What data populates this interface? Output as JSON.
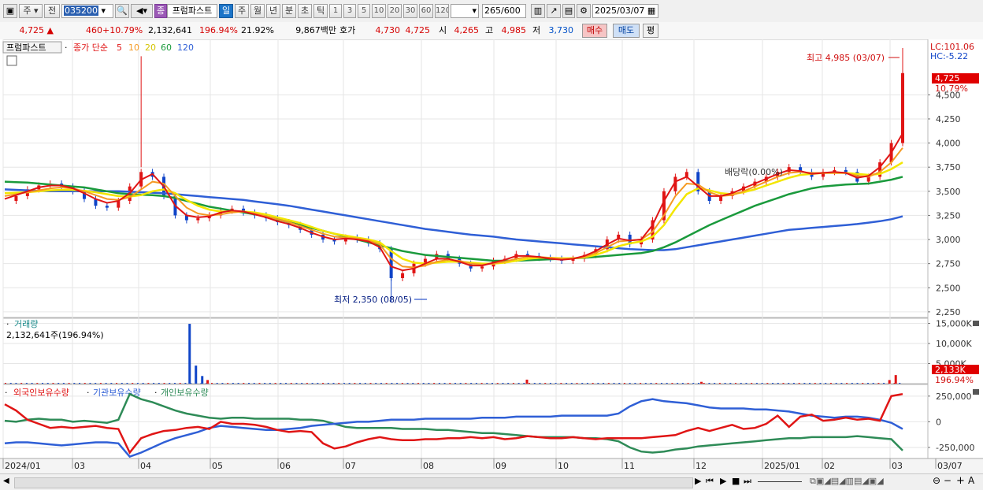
{
  "toolbar": {
    "market_label": "주",
    "prev_label": "전",
    "code": "035200",
    "name_badge": "종",
    "name": "프럼파스트",
    "periods": [
      "일",
      "주",
      "월",
      "년",
      "분",
      "초",
      "틱"
    ],
    "selected_period": "일",
    "minute_options": [
      "1",
      "3",
      "5",
      "10",
      "20",
      "30",
      "60",
      "120"
    ],
    "count_value": "265",
    "count_total": "/600",
    "date": "2025/03/07"
  },
  "quote": {
    "price": "4,725",
    "change": "460",
    "change_pct": "+10.79%",
    "volume": "2,132,641",
    "volume_ratio": "196.94%",
    "turnover": "21.92%",
    "amount": "9,867백만",
    "ask_label": "호가",
    "ask_price": "4,730",
    "bid_price": "4,725",
    "open_label": "시",
    "open": "4,265",
    "high_label": "고",
    "high": "4,985",
    "low_label": "저",
    "low": "3,730",
    "buy_label": "매수",
    "sell_label": "매도",
    "eval_label": "평"
  },
  "colors": {
    "up": "#e01515",
    "down": "#1045c8",
    "ma5": "#e01515",
    "ma10": "#f59a23",
    "ma20": "#f3e600",
    "ma60": "#1a9a3c",
    "ma120": "#2f5fd6",
    "foreign": "#e01515",
    "institution": "#2f5fd6",
    "individual": "#2e8b57"
  },
  "chart_data": [
    {
      "type": "line",
      "title": "프럼파스트",
      "legend": {
        "prefix": "종가 단순",
        "periods": [
          "5",
          "10",
          "20",
          "60",
          "120"
        ]
      },
      "ylim": [
        2200,
        5050
      ],
      "yticks": [
        "4,500",
        "4,250",
        "4,000",
        "3,750",
        "3,500",
        "3,250",
        "3,000",
        "2,750",
        "2,500",
        "2,250"
      ],
      "right_info": {
        "lc": "LC:101.06",
        "hc": "HC:-5.22",
        "last": "4,725",
        "last_pct": "10.79%"
      },
      "high_note": "최고 4,985 (03/07)",
      "low_note": "최저 2,350 (08/05)",
      "event_note": "배당락(0.00%)",
      "x_labels": [
        "2024/01",
        "03",
        "04",
        "05",
        "06",
        "07",
        "08",
        "09",
        "10",
        "11",
        "12",
        "2025/01",
        "02",
        "03",
        "03/07"
      ],
      "close": [
        3400,
        3450,
        3520,
        3560,
        3580,
        3550,
        3500,
        3420,
        3350,
        3330,
        3400,
        3550,
        3700,
        3650,
        3450,
        3250,
        3200,
        3220,
        3250,
        3300,
        3320,
        3280,
        3250,
        3220,
        3180,
        3150,
        3100,
        3050,
        3000,
        2980,
        3020,
        3000,
        2960,
        2900,
        2600,
        2650,
        2750,
        2800,
        2850,
        2800,
        2750,
        2700,
        2720,
        2780,
        2800,
        2850,
        2830,
        2810,
        2800,
        2780,
        2800,
        2840,
        2900,
        3000,
        3050,
        2950,
        3000,
        3200,
        3500,
        3650,
        3700,
        3500,
        3400,
        3450,
        3500,
        3550,
        3600,
        3650,
        3700,
        3750,
        3700,
        3650,
        3700,
        3720,
        3700,
        3600,
        3650,
        3800,
        4000,
        4725
      ],
      "ma5": [
        3420,
        3460,
        3500,
        3540,
        3560,
        3560,
        3530,
        3480,
        3420,
        3380,
        3400,
        3480,
        3620,
        3680,
        3550,
        3350,
        3250,
        3230,
        3240,
        3280,
        3300,
        3290,
        3260,
        3230,
        3190,
        3160,
        3120,
        3070,
        3030,
        3000,
        3010,
        3000,
        2980,
        2920,
        2720,
        2680,
        2700,
        2750,
        2800,
        2800,
        2770,
        2730,
        2730,
        2760,
        2790,
        2830,
        2830,
        2820,
        2800,
        2790,
        2800,
        2830,
        2880,
        2950,
        3010,
        2990,
        3000,
        3150,
        3400,
        3600,
        3650,
        3550,
        3450,
        3450,
        3480,
        3530,
        3580,
        3630,
        3680,
        3720,
        3710,
        3680,
        3690,
        3700,
        3690,
        3640,
        3660,
        3750,
        3900,
        4100
      ],
      "ma10": [
        3450,
        3470,
        3490,
        3510,
        3530,
        3540,
        3530,
        3500,
        3460,
        3420,
        3410,
        3440,
        3520,
        3600,
        3580,
        3450,
        3330,
        3270,
        3250,
        3260,
        3280,
        3290,
        3270,
        3240,
        3210,
        3180,
        3140,
        3100,
        3060,
        3030,
        3020,
        3010,
        2990,
        2950,
        2800,
        2720,
        2710,
        2730,
        2770,
        2790,
        2780,
        2750,
        2740,
        2750,
        2770,
        2800,
        2820,
        2820,
        2810,
        2800,
        2800,
        2820,
        2860,
        2920,
        2980,
        2990,
        3000,
        3080,
        3250,
        3450,
        3580,
        3570,
        3490,
        3450,
        3460,
        3500,
        3550,
        3600,
        3650,
        3690,
        3700,
        3690,
        3690,
        3690,
        3690,
        3660,
        3650,
        3700,
        3800,
        3950
      ],
      "ma20": [
        3480,
        3485,
        3490,
        3500,
        3510,
        3515,
        3515,
        3505,
        3490,
        3470,
        3450,
        3445,
        3460,
        3500,
        3520,
        3480,
        3410,
        3350,
        3310,
        3290,
        3290,
        3290,
        3280,
        3260,
        3230,
        3200,
        3170,
        3130,
        3090,
        3060,
        3040,
        3020,
        3000,
        2970,
        2880,
        2800,
        2760,
        2750,
        2760,
        2770,
        2770,
        2760,
        2750,
        2750,
        2760,
        2780,
        2800,
        2810,
        2810,
        2805,
        2805,
        2815,
        2840,
        2880,
        2930,
        2960,
        2980,
        3030,
        3150,
        3320,
        3470,
        3530,
        3510,
        3480,
        3470,
        3490,
        3520,
        3560,
        3600,
        3640,
        3670,
        3680,
        3690,
        3690,
        3690,
        3680,
        3670,
        3680,
        3730,
        3800
      ],
      "ma60": [
        3600,
        3595,
        3590,
        3580,
        3570,
        3560,
        3550,
        3540,
        3520,
        3500,
        3480,
        3470,
        3465,
        3460,
        3450,
        3430,
        3400,
        3370,
        3340,
        3320,
        3300,
        3280,
        3260,
        3240,
        3210,
        3180,
        3150,
        3120,
        3090,
        3060,
        3030,
        3000,
        2970,
        2940,
        2910,
        2880,
        2860,
        2840,
        2830,
        2820,
        2810,
        2800,
        2790,
        2780,
        2780,
        2780,
        2785,
        2790,
        2795,
        2800,
        2805,
        2810,
        2820,
        2830,
        2840,
        2850,
        2860,
        2880,
        2920,
        2970,
        3030,
        3090,
        3150,
        3200,
        3250,
        3300,
        3350,
        3390,
        3430,
        3470,
        3500,
        3530,
        3550,
        3560,
        3570,
        3575,
        3580,
        3600,
        3620,
        3650
      ],
      "ma120": [
        3520,
        3515,
        3510,
        3505,
        3500,
        3500,
        3500,
        3500,
        3500,
        3500,
        3500,
        3495,
        3490,
        3485,
        3480,
        3470,
        3460,
        3450,
        3440,
        3430,
        3420,
        3410,
        3395,
        3380,
        3365,
        3350,
        3330,
        3310,
        3290,
        3270,
        3250,
        3230,
        3210,
        3190,
        3170,
        3150,
        3130,
        3110,
        3095,
        3080,
        3065,
        3050,
        3040,
        3030,
        3015,
        3000,
        2990,
        2980,
        2970,
        2960,
        2950,
        2940,
        2930,
        2920,
        2910,
        2900,
        2895,
        2890,
        2890,
        2900,
        2920,
        2940,
        2960,
        2980,
        3000,
        3020,
        3040,
        3060,
        3080,
        3100,
        3110,
        3120,
        3130,
        3140,
        3150,
        3160,
        3175,
        3190,
        3210,
        3240
      ]
    },
    {
      "type": "bar",
      "title": "거래량",
      "value_label": "2,132,641주(196.94%)",
      "yticks": [
        "15,000K",
        "10,000K",
        "5,000K"
      ],
      "ylim": [
        0,
        15700
      ],
      "last_badge": "2,133K",
      "last_pct": "196.94%",
      "spikes": [
        {
          "pos": 0.206,
          "value": 14900
        },
        {
          "pos": 0.213,
          "value": 4500
        },
        {
          "pos": 0.22,
          "value": 1900
        },
        {
          "pos": 0.226,
          "value": 900
        },
        {
          "pos": 0.581,
          "value": 1000
        },
        {
          "pos": 0.775,
          "value": 450
        },
        {
          "pos": 0.984,
          "value": 900
        },
        {
          "pos": 0.991,
          "value": 2133
        }
      ],
      "baseline": 200
    },
    {
      "type": "line",
      "legend": [
        "외국인보유수량",
        "기관보유수량",
        "개인보유수량"
      ],
      "ylim": [
        -350000,
        310000
      ],
      "yticks": [
        "250,000",
        "0",
        "-250,000"
      ],
      "foreign": [
        170000,
        110000,
        20000,
        -20000,
        -60000,
        -50000,
        -60000,
        -50000,
        -40000,
        -60000,
        -70000,
        -300000,
        -160000,
        -120000,
        -90000,
        -80000,
        -60000,
        -50000,
        -70000,
        0,
        -20000,
        -20000,
        -30000,
        -50000,
        -80000,
        -100000,
        -90000,
        -100000,
        -210000,
        -260000,
        -240000,
        -200000,
        -170000,
        -150000,
        -170000,
        -180000,
        -180000,
        -170000,
        -170000,
        -160000,
        -160000,
        -150000,
        -160000,
        -150000,
        -170000,
        -160000,
        -140000,
        -150000,
        -160000,
        -160000,
        -150000,
        -160000,
        -170000,
        -160000,
        -160000,
        -160000,
        -160000,
        -150000,
        -140000,
        -130000,
        -90000,
        -60000,
        -90000,
        -60000,
        -30000,
        -70000,
        -60000,
        -20000,
        60000,
        -50000,
        50000,
        70000,
        10000,
        20000,
        40000,
        20000,
        30000,
        10000,
        250000,
        270000
      ],
      "institution": [
        -210000,
        -200000,
        -200000,
        -210000,
        -220000,
        -230000,
        -220000,
        -210000,
        -200000,
        -200000,
        -210000,
        -340000,
        -300000,
        -250000,
        -200000,
        -160000,
        -130000,
        -100000,
        -60000,
        -40000,
        -50000,
        -60000,
        -70000,
        -80000,
        -80000,
        -70000,
        -60000,
        -40000,
        -30000,
        -20000,
        -10000,
        0,
        0,
        10000,
        20000,
        20000,
        20000,
        30000,
        30000,
        30000,
        30000,
        30000,
        40000,
        40000,
        40000,
        50000,
        50000,
        50000,
        50000,
        60000,
        60000,
        60000,
        60000,
        60000,
        80000,
        150000,
        200000,
        220000,
        200000,
        190000,
        180000,
        160000,
        140000,
        130000,
        130000,
        130000,
        120000,
        120000,
        110000,
        100000,
        80000,
        60000,
        50000,
        40000,
        50000,
        50000,
        40000,
        20000,
        -10000,
        -70000
      ],
      "individual": [
        10000,
        0,
        20000,
        30000,
        20000,
        20000,
        0,
        10000,
        0,
        -10000,
        20000,
        270000,
        220000,
        190000,
        150000,
        110000,
        80000,
        60000,
        40000,
        30000,
        40000,
        40000,
        30000,
        30000,
        30000,
        30000,
        20000,
        20000,
        10000,
        -20000,
        -50000,
        -60000,
        -60000,
        -60000,
        -60000,
        -70000,
        -70000,
        -70000,
        -80000,
        -80000,
        -90000,
        -100000,
        -110000,
        -110000,
        -120000,
        -130000,
        -140000,
        -150000,
        -150000,
        -150000,
        -150000,
        -160000,
        -160000,
        -170000,
        -190000,
        -250000,
        -290000,
        -300000,
        -290000,
        -270000,
        -260000,
        -240000,
        -230000,
        -220000,
        -210000,
        -200000,
        -190000,
        -180000,
        -170000,
        -160000,
        -160000,
        -150000,
        -150000,
        -150000,
        -150000,
        -140000,
        -150000,
        -160000,
        -170000,
        -280000
      ]
    }
  ],
  "nav_icons": [
    "play-icon",
    "rewind-icon",
    "fast-forward-icon",
    "stop-icon",
    "skip-end-icon",
    "zoom-slider-icon",
    "zoom-out-icon",
    "zoom-in-icon",
    "font-icon"
  ]
}
